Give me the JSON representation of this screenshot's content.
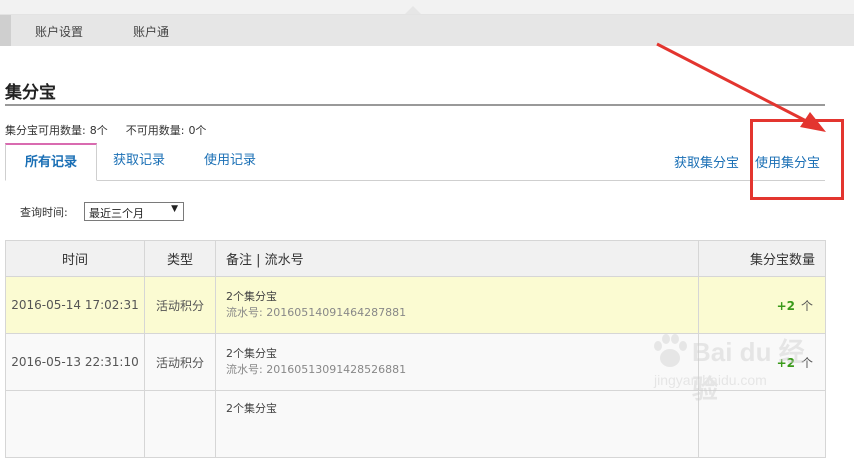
{
  "subnav": {
    "items": [
      {
        "label": "账户设置"
      },
      {
        "label": "账户通"
      }
    ]
  },
  "page": {
    "title": "集分宝"
  },
  "counts": {
    "available_label": "集分宝可用数量:",
    "available_value": "8个",
    "unavailable_label": "不可用数量:",
    "unavailable_value": "0个"
  },
  "tabs": [
    {
      "label": "所有记录",
      "active": true
    },
    {
      "label": "获取记录",
      "active": false
    },
    {
      "label": "使用记录",
      "active": false
    }
  ],
  "actions": {
    "get_label": "获取集分宝",
    "use_label": "使用集分宝"
  },
  "query": {
    "label": "查询时间:",
    "selected": "最近三个月"
  },
  "table": {
    "headers": [
      "时间",
      "类型",
      "备注 | 流水号",
      "集分宝数量"
    ],
    "rows": [
      {
        "time": "2016-05-14 17:02:31",
        "type": "活动积分",
        "note": "2个集分宝",
        "serial": "流水号: 20160514091464287881",
        "amount": "+2",
        "unit": "个"
      },
      {
        "time": "2016-05-13 22:31:10",
        "type": "活动积分",
        "note": "2个集分宝",
        "serial": "流水号: 20160513091428526881",
        "amount": "+2",
        "unit": "个"
      },
      {
        "time": "",
        "type": "",
        "note": "2个集分宝",
        "serial": "",
        "amount": "",
        "unit": ""
      }
    ]
  },
  "watermark": {
    "brand": "Bai du 经验",
    "site": "jingyan.baidu.com"
  },
  "colors": {
    "link": "#1a6fb5",
    "highlight_row": "#fbfbd2",
    "positive": "#3a9a1a",
    "annotation": "#e3352f",
    "active_tab_border": "#d96bb0"
  }
}
